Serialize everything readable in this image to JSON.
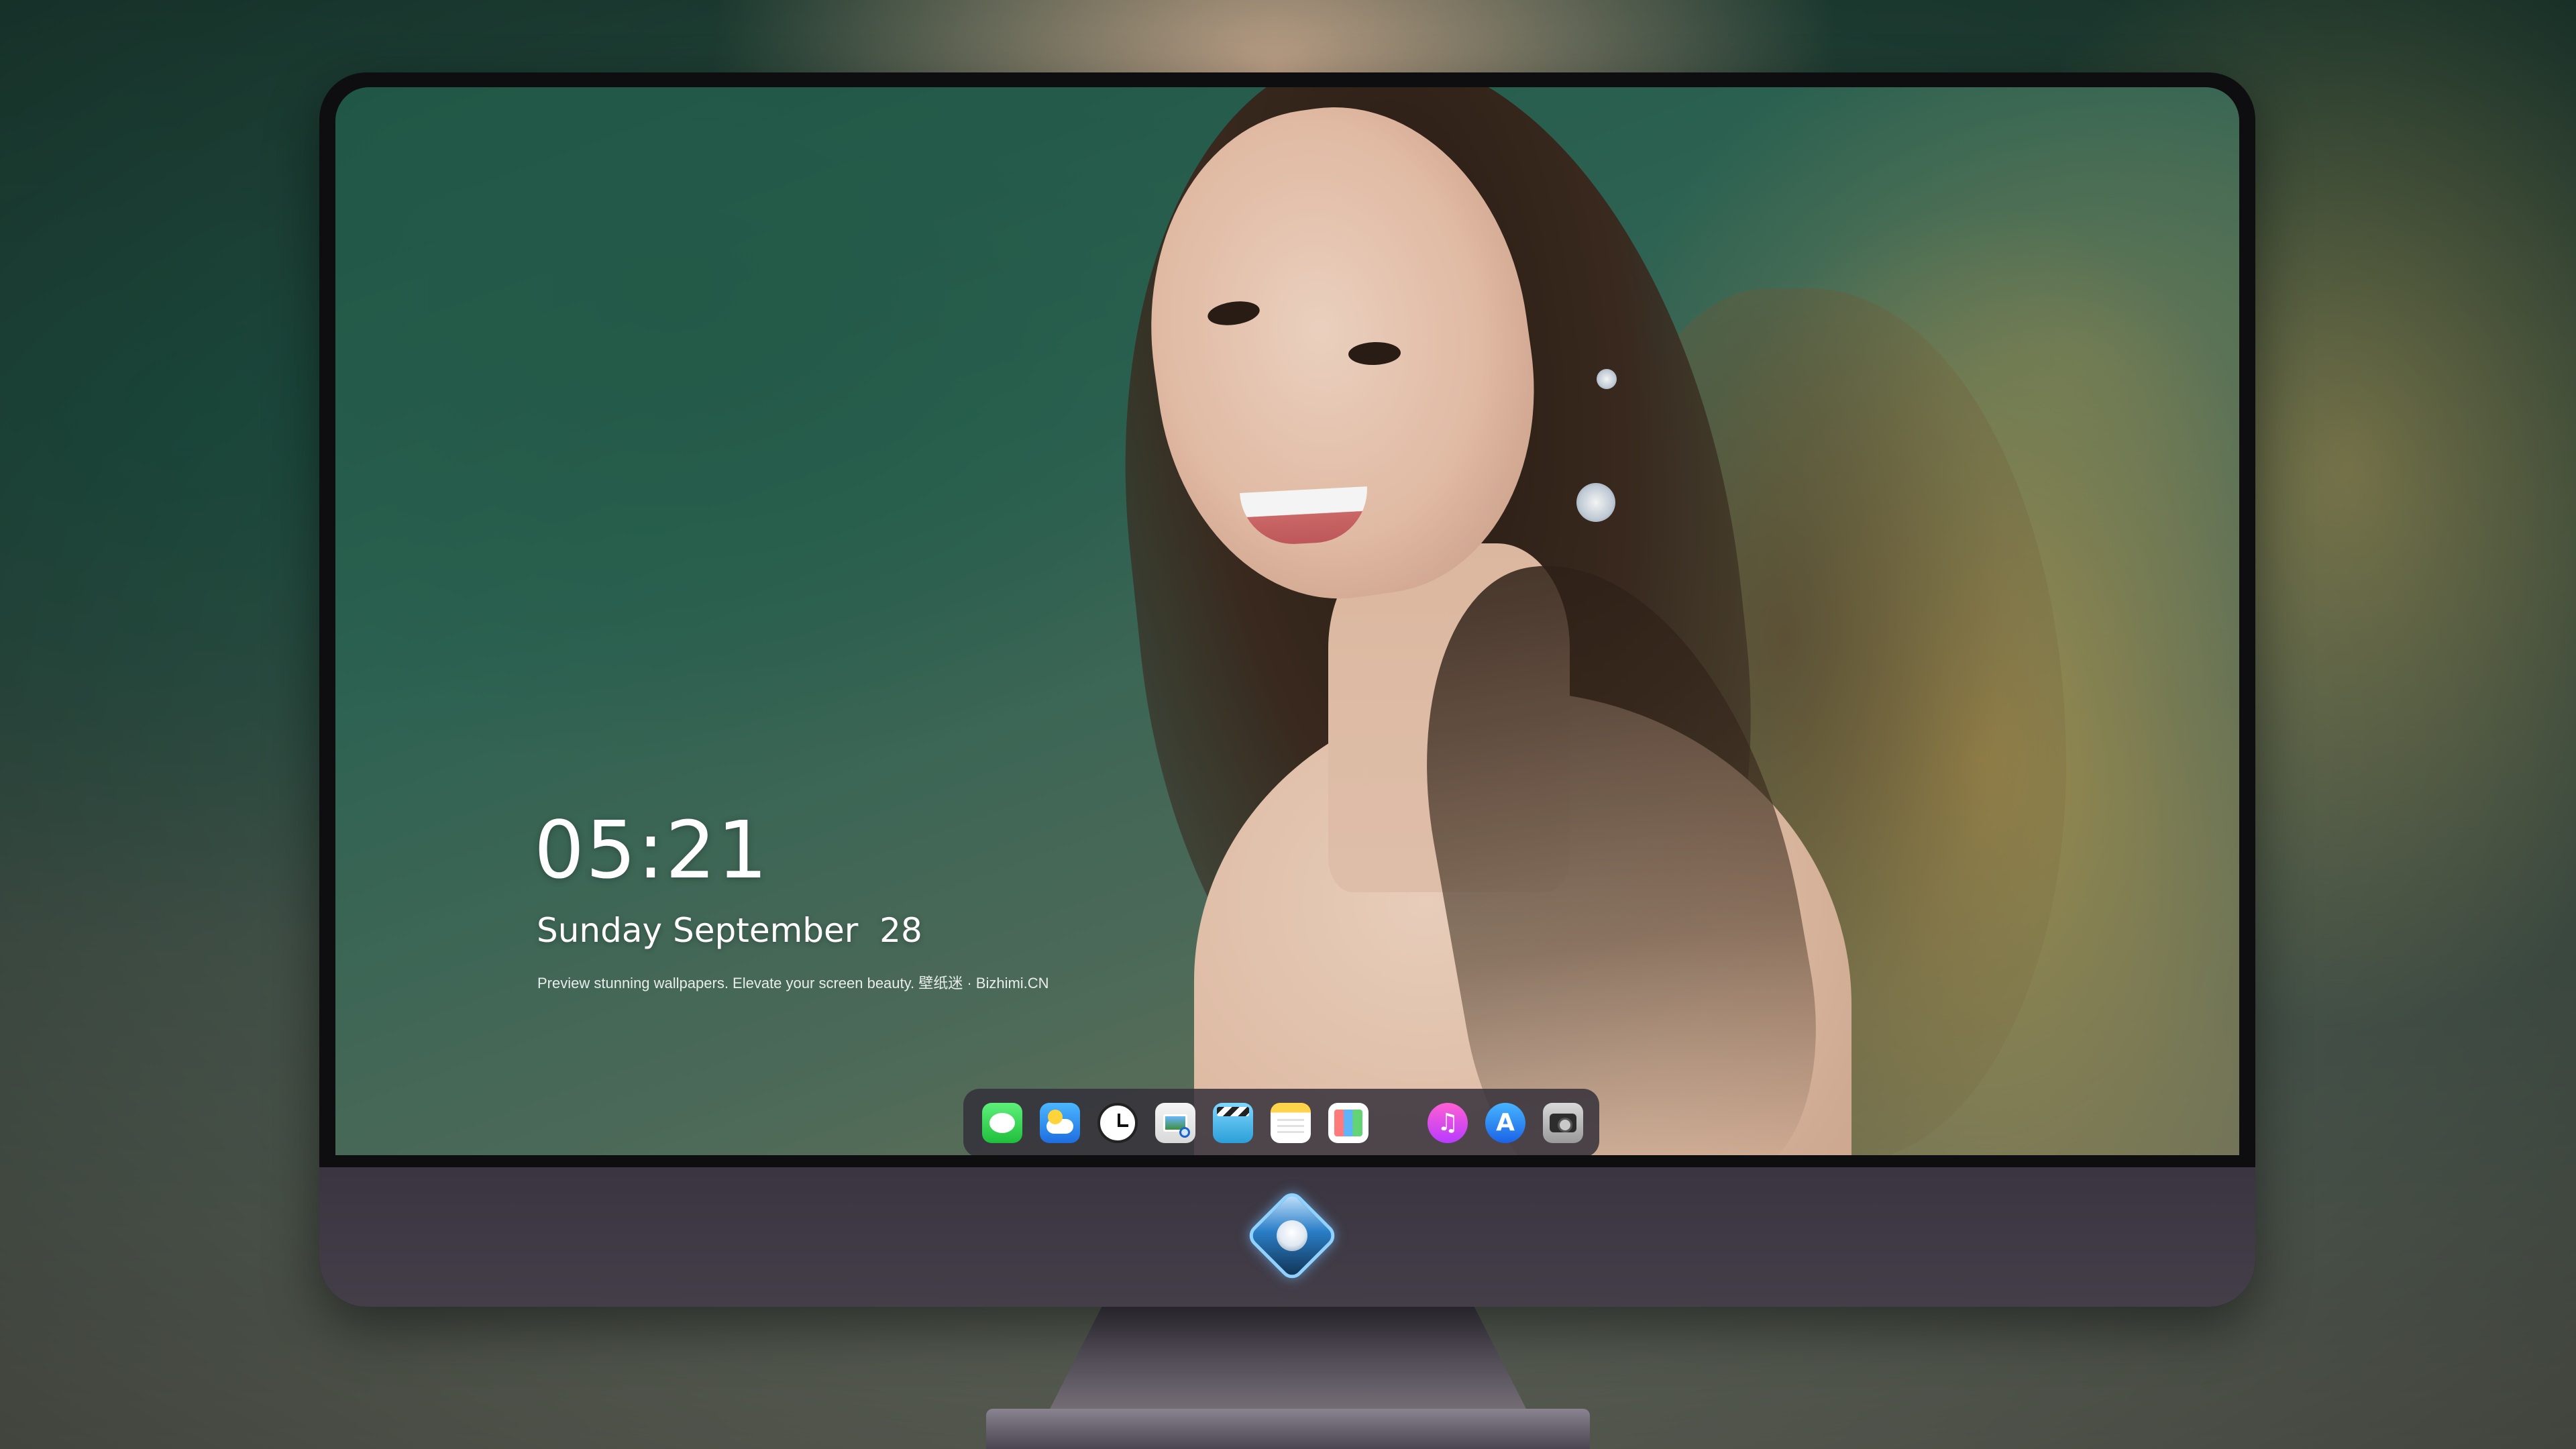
{
  "lockscreen": {
    "time": "05:21",
    "date": "Sunday September  28",
    "tagline": "Preview stunning wallpapers. Elevate your screen beauty. 壁纸迷 · Bizhimi.CN"
  },
  "dock": {
    "apps": [
      {
        "name": "messages",
        "icon": "message-bubble-icon"
      },
      {
        "name": "weather",
        "icon": "cloud-sun-icon"
      },
      {
        "name": "clock",
        "icon": "clock-icon"
      },
      {
        "name": "preview",
        "icon": "photo-magnifier-icon"
      },
      {
        "name": "video",
        "icon": "clapperboard-icon"
      },
      {
        "name": "notes",
        "icon": "notepad-icon"
      },
      {
        "name": "calendar",
        "icon": "calendar-grid-icon"
      },
      {
        "name": "music",
        "icon": "music-note-icon",
        "glyph": "♫"
      },
      {
        "name": "app-store",
        "icon": "app-store-icon",
        "glyph": "A"
      },
      {
        "name": "camera",
        "icon": "camera-icon"
      }
    ]
  },
  "monitor": {
    "chin_logo": "mascot-logo-icon"
  },
  "colors": {
    "wallpaper_green": "#245c4a",
    "wallpaper_gold": "#b0964f",
    "dock_bg": "#34303a",
    "monitor_chin": "#3a3540"
  }
}
